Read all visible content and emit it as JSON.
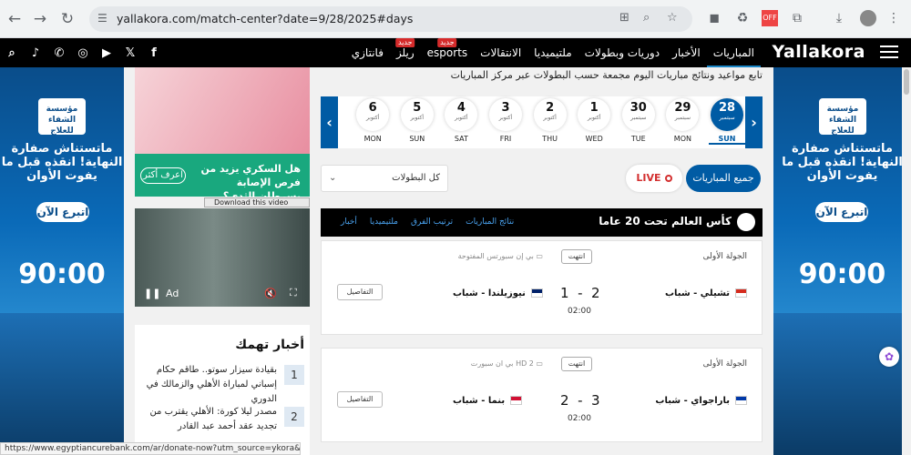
{
  "browser": {
    "url": "yallakora.com/match-center?date=9/28/2025#days",
    "back": "←",
    "forward": "→",
    "reload": "↻"
  },
  "header": {
    "logo": "Yallakora",
    "nav": [
      {
        "label": "المباريات",
        "badge": ""
      },
      {
        "label": "الأخبار",
        "badge": ""
      },
      {
        "label": "دوريات وبطولات",
        "badge": ""
      },
      {
        "label": "ملتيميديا",
        "badge": ""
      },
      {
        "label": "الانتقالات",
        "badge": ""
      },
      {
        "label": "esports",
        "badge": "جديد"
      },
      {
        "label": "ريلز",
        "badge": "جديد"
      },
      {
        "label": "فانتازي",
        "badge": ""
      }
    ],
    "social": [
      "f",
      "𝕏",
      "▶",
      "◎",
      "✆",
      "♪",
      "⌕"
    ]
  },
  "side_ad": {
    "logo_text": "مؤسسة الشفاء للعلاج",
    "text": "ماتستناش صفارة النهاية! انقذه قبل ما يفوت الأوان",
    "button": "اتبرع الآن",
    "score": "90:00"
  },
  "promo": {
    "title": "هل السكري يزيد من فرص الإصابة بسرطان الثدي؟",
    "button": "اعرف أكثر"
  },
  "video": {
    "download_label": "Download this video",
    "ad_label": "Ad"
  },
  "news": {
    "title": "أخبار تهمك",
    "items": [
      {
        "num": "1",
        "text": "بقيادة سيزار سوتو.. طاقم حكام إسباني لمباراة الأهلي والزمالك في الدوري"
      },
      {
        "num": "2",
        "text": "مصدر ليلا كورة: الأهلي يقترب من تجديد عقد أحمد عبد القادر"
      }
    ]
  },
  "main": {
    "intro": "تابع مواعيد ونتائج مباريات اليوم مجمعة حسب البطولات عبر مركز المباريات",
    "dates": [
      {
        "num": "28",
        "month": "سبتمبر",
        "day": "SUN",
        "active": true
      },
      {
        "num": "29",
        "month": "سبتمبر",
        "day": "MON",
        "active": false
      },
      {
        "num": "30",
        "month": "سبتمبر",
        "day": "TUE",
        "active": false
      },
      {
        "num": "1",
        "month": "أكتوبر",
        "day": "WED",
        "active": false
      },
      {
        "num": "2",
        "month": "أكتوبر",
        "day": "THU",
        "active": false
      },
      {
        "num": "3",
        "month": "أكتوبر",
        "day": "FRI",
        "active": false
      },
      {
        "num": "4",
        "month": "أكتوبر",
        "day": "SAT",
        "active": false
      },
      {
        "num": "5",
        "month": "أكتوبر",
        "day": "SUN",
        "active": false
      },
      {
        "num": "6",
        "month": "أكتوبر",
        "day": "MON",
        "active": false
      }
    ],
    "filter_all": "جميع المباريات",
    "filter_live": "LIVE",
    "championship_select": "كل البطولات"
  },
  "competition": {
    "name": "كأس العالم تحت 20 عاما",
    "tabs": [
      "نتائج المباريات",
      "ترتيب الفرق",
      "ملتيميديا",
      "أخبار"
    ]
  },
  "matches": [
    {
      "round": "الجولة الأولى",
      "status": "انتهت",
      "channel": "بي إن سبورتس المفتوحة",
      "home": "تشيلي - شباب",
      "away": "نيوزيلندا - شباب",
      "home_score": "2",
      "away_score": "1",
      "time": "02:00",
      "details": "التفاصيل",
      "home_flag": "#d52b1e",
      "away_flag": "#012169"
    },
    {
      "round": "الجولة الأولى",
      "status": "انتهت",
      "channel": "بي ان سبورت HD 2",
      "home": "باراجواي - شباب",
      "away": "بنما - شباب",
      "home_score": "3",
      "away_score": "2",
      "time": "02:00",
      "details": "التفاصيل",
      "home_flag": "#0038a8",
      "away_flag": "#d21034"
    }
  ],
  "status_url": "https://www.egyptiancurebank.com/ar/donate-now?utm_source=ykora&utm..."
}
